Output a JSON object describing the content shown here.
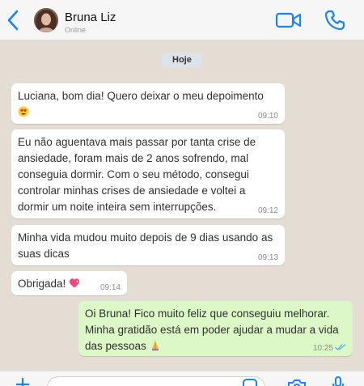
{
  "header": {
    "contact_name": "Bruna Liz",
    "status": "Online",
    "back_icon": "chevron-left-icon",
    "video_icon": "video-camera-icon",
    "call_icon": "phone-icon"
  },
  "chat": {
    "date_label": "Hoje",
    "messages": [
      {
        "direction": "in",
        "text": "Luciana, bom dia! Quero deixar o meu depoimento",
        "emoji": "heart-eyes",
        "time": "09:10"
      },
      {
        "direction": "in",
        "text": "Eu não aguentava mais passar por tanta crise de ansiedade, foram mais de 2 anos sofrendo, mal conseguia dormir. Com o seu método, consegui controlar minhas crises de ansiedade e voltei a dormir um noite inteira sem interrupções.",
        "time": "09:12"
      },
      {
        "direction": "in",
        "text": "Minha vida mudou muito depois de 9 dias usando as suas dicas",
        "time": "09:13"
      },
      {
        "direction": "in",
        "text": "Obrigada!",
        "emoji": "sparkling-heart",
        "time": "09:14"
      },
      {
        "direction": "out",
        "text": "Oi Bruna! Fico muito feliz que conseguiu melhorar. Minha gratidão está em poder ajudar a mudar a vida das pessoas",
        "emoji": "folded-hands",
        "time": "10:25",
        "status": "read"
      }
    ]
  },
  "composer": {
    "placeholder": "",
    "plus_icon": "plus-icon",
    "sticker_icon": "sticker-icon",
    "camera_icon": "camera-icon",
    "mic_icon": "microphone-icon"
  },
  "colors": {
    "accent": "#1a82fb",
    "incoming_bubble": "#ffffff",
    "outgoing_bubble": "#dcf8c6",
    "chat_background": "#e4ddd4",
    "read_ticks": "#4fb6ec"
  }
}
